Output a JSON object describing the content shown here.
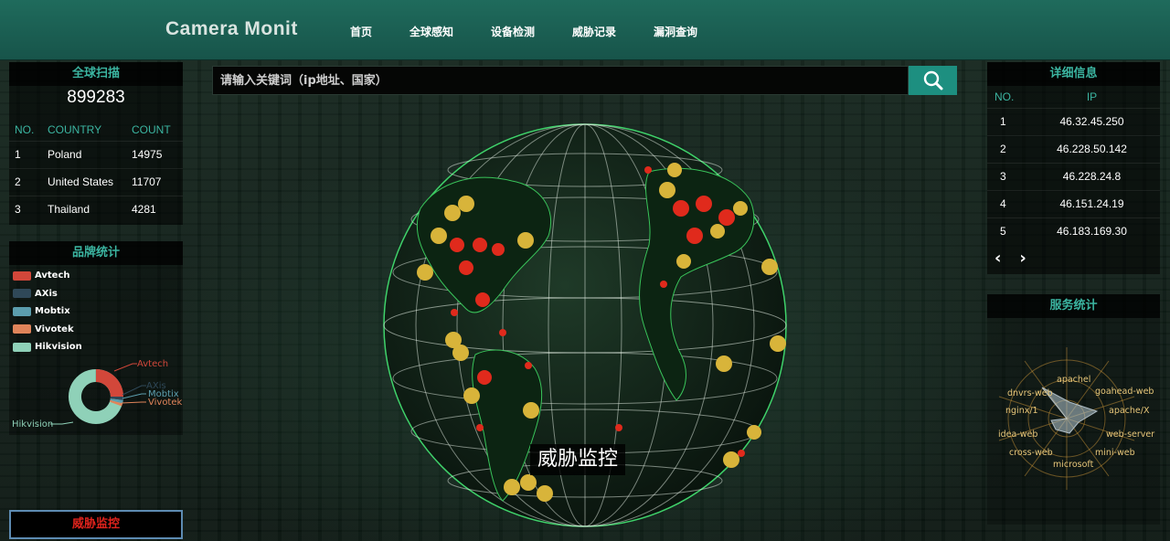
{
  "app": {
    "logo": "Camera Monit"
  },
  "nav": [
    "首页",
    "全球感知",
    "设备检测",
    "威胁记录",
    "漏洞查询"
  ],
  "scan": {
    "title": "全球扫描",
    "total": "899283",
    "headers": [
      "NO.",
      "COUNTRY",
      "COUNT"
    ],
    "rows": [
      {
        "no": "1",
        "country": "Poland",
        "count": "14975"
      },
      {
        "no": "2",
        "country": "United States",
        "count": "11707"
      },
      {
        "no": "3",
        "country": "Thailand",
        "count": "4281"
      }
    ]
  },
  "brand": {
    "title": "品牌统计",
    "legend": [
      {
        "name": "Avtech",
        "color": "#d2473a"
      },
      {
        "name": "AXis",
        "color": "#2f4858"
      },
      {
        "name": "Mobtix",
        "color": "#5c9eae"
      },
      {
        "name": "Vivotek",
        "color": "#e0845a"
      },
      {
        "name": "Hikvision",
        "color": "#8fd1b8"
      }
    ],
    "donut_labels": [
      "Avtech",
      "AXis",
      "Mobtix",
      "Vivotek",
      "Hikvision"
    ]
  },
  "search": {
    "placeholder": "请输入关键词（ip地址、国家）"
  },
  "globe_label": "威胁监控",
  "alarm_button": "威胁监控",
  "detail": {
    "title": "详细信息",
    "headers": [
      "NO.",
      "IP"
    ],
    "rows": [
      {
        "no": "1",
        "ip": "46.32.45.250"
      },
      {
        "no": "2",
        "ip": "46.228.50.142"
      },
      {
        "no": "3",
        "ip": "46.228.24.8"
      },
      {
        "no": "4",
        "ip": "46.151.24.19"
      },
      {
        "no": "5",
        "ip": "46.183.169.30"
      }
    ],
    "prev": "‹",
    "next": "›"
  },
  "service": {
    "title": "服务统计",
    "labels": [
      "apachel",
      "goahead-web",
      "apache/X",
      "web-server",
      "mini-web",
      "microsoft",
      "cross-web",
      "idea-web",
      "nginx/1",
      "dnvrs-web"
    ]
  }
}
